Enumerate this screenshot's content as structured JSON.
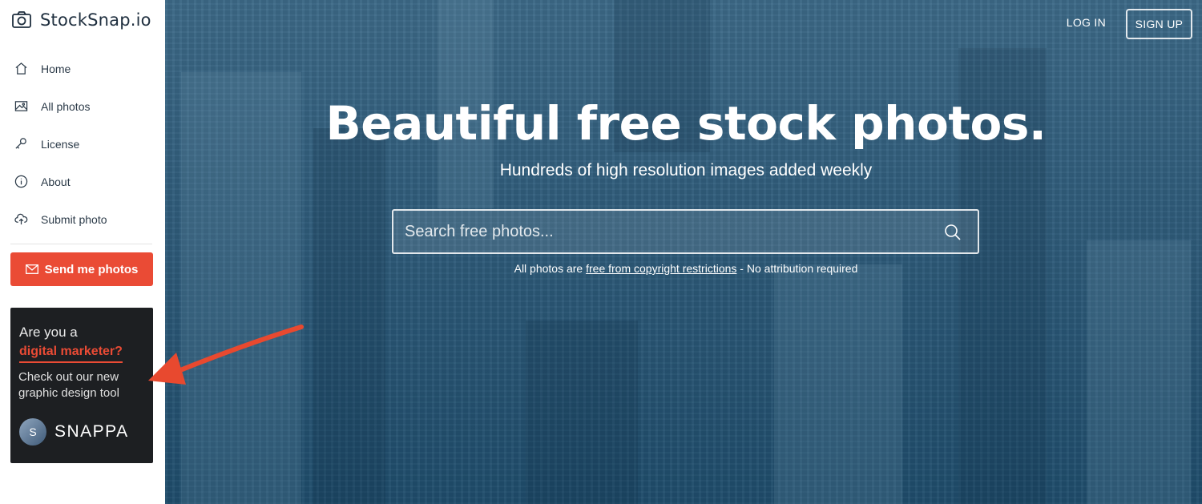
{
  "brand": {
    "name": "StockSnap.io",
    "accent": "#ea4b35"
  },
  "sidebar": {
    "items": [
      {
        "label": "Home",
        "icon": "home-icon"
      },
      {
        "label": "All photos",
        "icon": "image-icon"
      },
      {
        "label": "License",
        "icon": "key-icon"
      },
      {
        "label": "About",
        "icon": "info-icon"
      },
      {
        "label": "Submit photo",
        "icon": "upload-cloud-icon"
      }
    ],
    "send_button": "Send me photos"
  },
  "ad": {
    "line1": "Are you a",
    "line2": "digital marketer?",
    "line3": "Check out our new graphic design tool",
    "logo_letter": "S",
    "logo_name": "SNAPPA"
  },
  "header": {
    "login": "LOG IN",
    "signup": "SIGN UP"
  },
  "hero": {
    "title": "Beautiful free stock photos.",
    "subtitle": "Hundreds of high resolution images added weekly",
    "search_placeholder": "Search free photos...",
    "note_prefix": "All photos are ",
    "note_link": "free from copyright restrictions",
    "note_suffix": " - No attribution required"
  }
}
